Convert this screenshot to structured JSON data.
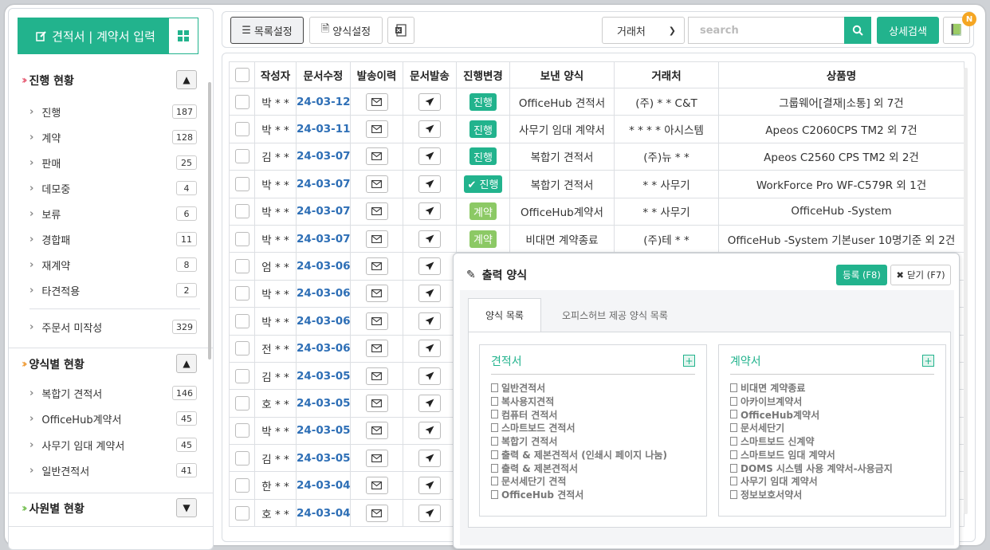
{
  "sidebar": {
    "input_button": "견적서 | 계약서 입력",
    "sections": [
      {
        "title": "진행 현황",
        "items": [
          {
            "label": "진행",
            "count": "187"
          },
          {
            "label": "계약",
            "count": "128"
          },
          {
            "label": "판매",
            "count": "25"
          },
          {
            "label": "데모중",
            "count": "4"
          },
          {
            "label": "보류",
            "count": "6"
          },
          {
            "label": "경합패",
            "count": "11"
          },
          {
            "label": "재계약",
            "count": "8"
          },
          {
            "label": "타견적용",
            "count": "2"
          },
          {
            "label": "주문서 미작성",
            "count": "329"
          }
        ]
      },
      {
        "title": "양식별 현황",
        "items": [
          {
            "label": "복합기 견적서",
            "count": "146"
          },
          {
            "label": "OfficeHub계약서",
            "count": "45"
          },
          {
            "label": "사무기 임대 계약서",
            "count": "45"
          },
          {
            "label": "일반견적서",
            "count": "41"
          }
        ]
      },
      {
        "title": "사원별 현황",
        "items": []
      }
    ]
  },
  "toolbar": {
    "list_settings": "목록설정",
    "form_settings": "양식설정",
    "filter_select": "거래처",
    "search_placeholder": "search",
    "advanced_search": "상세검색",
    "notification_badge": "N"
  },
  "table": {
    "headers": [
      "작성자",
      "문서수정",
      "발송이력",
      "문서발송",
      "진행변경",
      "보낸 양식",
      "거래처",
      "상품명"
    ],
    "rows": [
      {
        "author": "박 * *",
        "date": "24-03-12",
        "status": "진행",
        "status_type": "go",
        "form": "OfficeHub 견적서",
        "client": "(주) * * C&T",
        "product": "그룹웨어[결재|소통] 외 7건"
      },
      {
        "author": "박 * *",
        "date": "24-03-11",
        "status": "진행",
        "status_type": "go",
        "form": "사무기 임대 계약서",
        "client": "* * * * 아시스템",
        "product": "Apeos C2060CPS TM2 외 7건"
      },
      {
        "author": "김 * *",
        "date": "24-03-07",
        "status": "진행",
        "status_type": "go",
        "form": "복합기 견적서",
        "client": "(주)뉴 * *",
        "product": "Apeos C2560 CPS TM2 외 2건"
      },
      {
        "author": "박 * *",
        "date": "24-03-07",
        "status": "✔ 진행",
        "status_type": "go",
        "form": "복합기 견적서",
        "client": "* * 사무기",
        "product": "WorkForce Pro WF-C579R 외 1건"
      },
      {
        "author": "박 * *",
        "date": "24-03-07",
        "status": "계약",
        "status_type": "ok",
        "form": "OfficeHub계약서",
        "client": "* * 사무기",
        "product": "OfficeHub -System"
      },
      {
        "author": "박 * *",
        "date": "24-03-07",
        "status": "계약",
        "status_type": "ok",
        "form": "비대면 계약종료",
        "client": "(주)테 * *",
        "product": "OfficeHub -System 기본user 10명기준 외 2건"
      },
      {
        "author": "엄 * *",
        "date": "24-03-06",
        "status": "",
        "status_type": "",
        "form": "",
        "client": "",
        "product": ""
      },
      {
        "author": "박 * *",
        "date": "24-03-06",
        "status": "",
        "status_type": "",
        "form": "",
        "client": "",
        "product": ""
      },
      {
        "author": "박 * *",
        "date": "24-03-06",
        "status": "",
        "status_type": "",
        "form": "",
        "client": "",
        "product": ""
      },
      {
        "author": "전 * *",
        "date": "24-03-06",
        "status": "",
        "status_type": "",
        "form": "",
        "client": "",
        "product": ""
      },
      {
        "author": "김 * *",
        "date": "24-03-05",
        "status": "",
        "status_type": "",
        "form": "",
        "client": "",
        "product": ""
      },
      {
        "author": "호 * *",
        "date": "24-03-05",
        "status": "",
        "status_type": "",
        "form": "",
        "client": "",
        "product": ""
      },
      {
        "author": "박 * *",
        "date": "24-03-05",
        "status": "",
        "status_type": "",
        "form": "",
        "client": "",
        "product": ""
      },
      {
        "author": "김 * *",
        "date": "24-03-05",
        "status": "",
        "status_type": "",
        "form": "",
        "client": "",
        "product": ""
      },
      {
        "author": "한 * *",
        "date": "24-03-04",
        "status": "",
        "status_type": "",
        "form": "",
        "client": "",
        "product": ""
      },
      {
        "author": "호 * *",
        "date": "24-03-04",
        "status": "",
        "status_type": "",
        "form": "",
        "client": "",
        "product": ""
      }
    ]
  },
  "popup": {
    "title": "출력 양식",
    "register_button": "등록 (F8)",
    "close_button": "닫기 (F7)",
    "tabs": [
      "양식 목록",
      "오피스허브 제공 양식 목록"
    ],
    "cards": [
      {
        "title": "견적서",
        "items": [
          "일반견적서",
          "복사용지견적",
          "컴퓨터 견적서",
          "스마트보드 견적서",
          "복합기 견적서",
          "출력 & 제본견적서 (인쇄시 페이지 나눔)",
          "출력 & 제본견적서",
          "문서세단기 견적",
          "OfficeHub 견적서"
        ]
      },
      {
        "title": "계약서",
        "items": [
          "비대면 계약종료",
          "아카이브계약서",
          "OfficeHub계약서",
          "문서세단기",
          "스마트보드 신계약",
          "스마트보드 임대 계약서",
          "DOMS 시스템 사용 계약서-사용금지",
          "사무기 임대 계약서",
          "정보보호서약서"
        ]
      }
    ]
  },
  "colors": {
    "accent": "#22b38d",
    "contract": "#8cc965",
    "date": "#2e6fb6",
    "badge": "#f5a623"
  }
}
